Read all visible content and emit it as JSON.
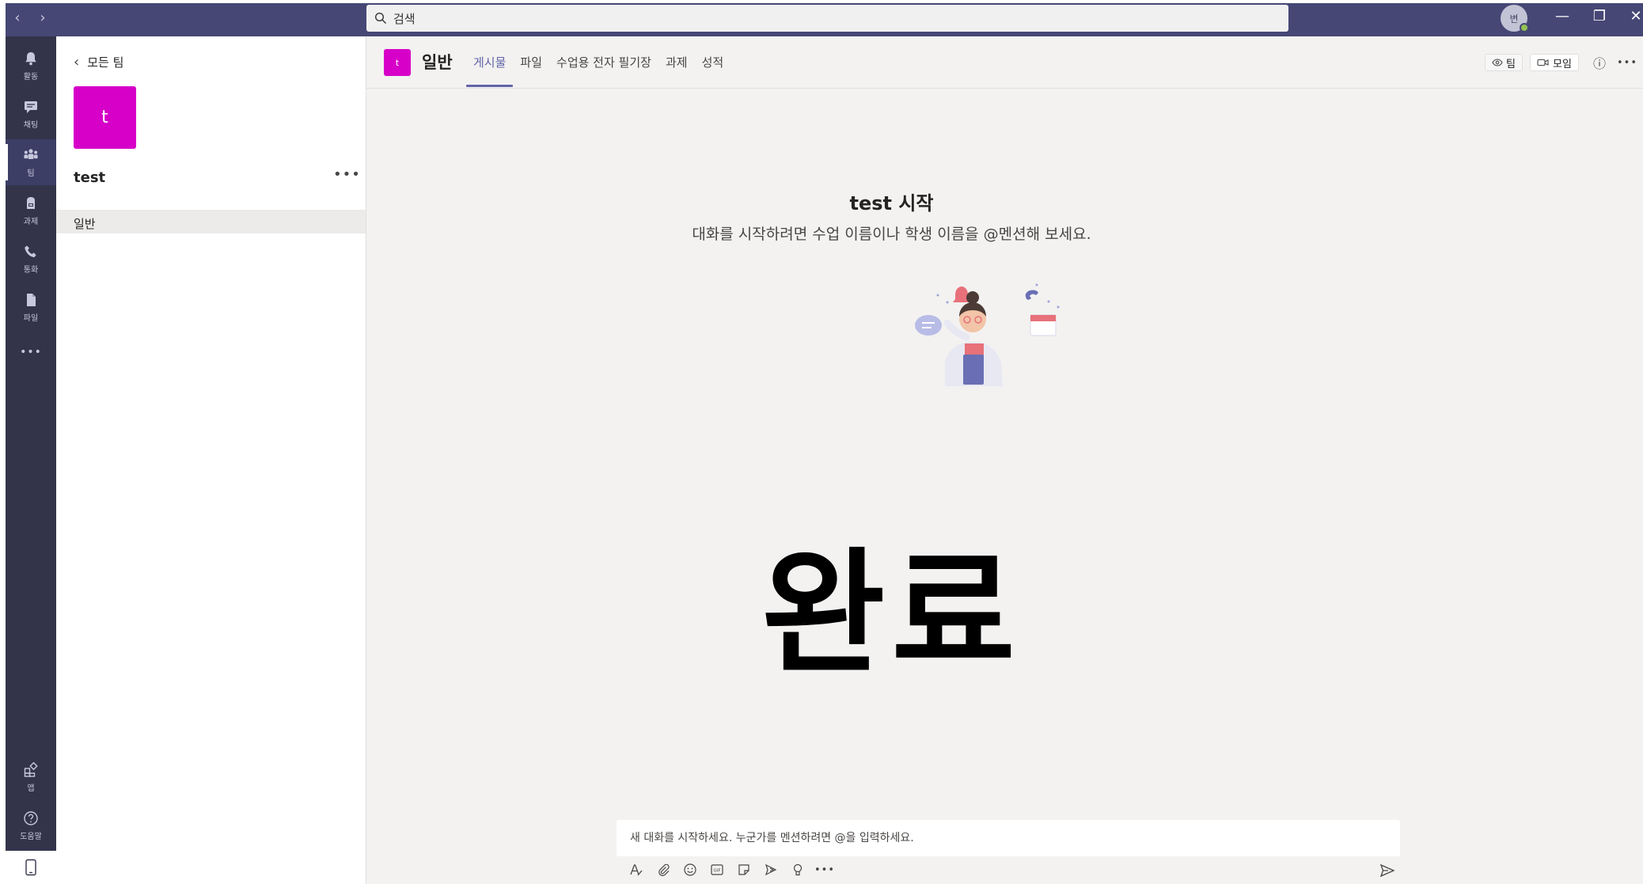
{
  "titlebar": {
    "search_placeholder": "검색",
    "avatar_initial": "변",
    "minimize_symbol": "—",
    "restore_symbol": "❐",
    "close_symbol": "✕",
    "back_symbol": "‹",
    "forward_symbol": "›"
  },
  "rail": {
    "items": [
      {
        "label": "활동",
        "icon": "bell-icon"
      },
      {
        "label": "채팅",
        "icon": "chat-icon"
      },
      {
        "label": "팀",
        "icon": "teams-icon"
      },
      {
        "label": "과제",
        "icon": "assignments-icon"
      },
      {
        "label": "통화",
        "icon": "phone-icon"
      },
      {
        "label": "파일",
        "icon": "file-icon"
      }
    ],
    "more_label": "•••",
    "apps_label": "앱",
    "help_label": "도움말"
  },
  "teams_panel": {
    "back_label": "모든 팀",
    "team_initial": "t",
    "team_name": "test",
    "more_label": "•••",
    "channel": "일반"
  },
  "channel_header": {
    "avatar_initial": "t",
    "title": "일반",
    "tabs": [
      "게시물",
      "파일",
      "수업용 전자 필기장",
      "과제",
      "성적"
    ],
    "active_tab": 0,
    "team_button": "팀",
    "meet_button": "모임",
    "info_symbol": "ⓘ",
    "more_symbol": "•••"
  },
  "welcome": {
    "title": "test 시작",
    "subtitle": "대화를 시작하려면 수업 이름이나 학생 이름을 @멘션해 보세요."
  },
  "overlay_text": "완료",
  "composer": {
    "placeholder": "새 대화를 시작하세요. 누군가를 멘션하려면 @을 입력하세요.",
    "more_symbol": "•••"
  },
  "colors": {
    "titlebar": "#464775",
    "rail": "#33344a",
    "accent": "#6264a7",
    "team_tile": "#d600c8",
    "main_bg": "#f3f2f1"
  }
}
